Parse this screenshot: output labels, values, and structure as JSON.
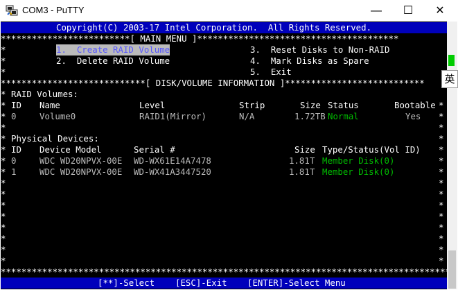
{
  "window": {
    "title": "COM3 - PuTTY",
    "minimize_glyph": "—",
    "maximize_glyph": "☐",
    "close_glyph": "✕"
  },
  "header": {
    "copyright": "Copyright(C) 2003-17 Intel Corporation.  All Rights Reserved."
  },
  "main_menu": {
    "border_line": "*************************[ MAIN MENU ]***************************************",
    "items": [
      {
        "label": "1.  Create RAID Volume"
      },
      {
        "label": "2.  Delete RAID Volume"
      },
      {
        "label": "3.  Reset Disks to Non-RAID"
      },
      {
        "label": "4.  Mark Disks as Spare"
      },
      {
        "label": "5.  Exit"
      }
    ]
  },
  "disk_info": {
    "border_line": "****************************[ DISK/VOLUME INFORMATION ]***************************"
  },
  "raid_volumes": {
    "title": "RAID Volumes:",
    "columns": {
      "id": "ID",
      "name": "Name",
      "level": "Level",
      "strip": "Strip",
      "size": "Size",
      "status": "Status",
      "bootable": "Bootable"
    },
    "rows": [
      {
        "id": "0",
        "name": "Volume0",
        "level": "RAID1(Mirror)",
        "strip": "N/A",
        "size": "1.72TB",
        "status": "Normal",
        "bootable": "Yes"
      }
    ]
  },
  "physical_devices": {
    "title": "Physical Devices:",
    "columns": {
      "id": "ID",
      "model": "Device Model",
      "serial": "Serial #",
      "size": "Size",
      "type_status": "Type/Status(Vol ID)"
    },
    "rows": [
      {
        "id": "0",
        "model": "WDC WD20NPVX-00E",
        "serial": "WD-WX61E14A7478",
        "size": "1.81T",
        "type_status": "Member Disk(0)"
      },
      {
        "id": "1",
        "model": "WDC WD20NPVX-00E",
        "serial": "WD-WX41A3447520",
        "size": "1.81T",
        "type_status": "Member Disk(0)"
      }
    ]
  },
  "footer": {
    "select": "[**]-Select",
    "esc": "[ESC]-Exit",
    "enter": "[ENTER]-Select Menu"
  },
  "border": {
    "side_star": "*",
    "bottom_line": "******************************************************************************************"
  },
  "ime": {
    "label": "英"
  },
  "colors": {
    "terminal_bg": "#000000",
    "band_bg": "#0000bb",
    "text": "#bbbbbb",
    "cyan": "#55ffff",
    "green": "#00bb00",
    "highlight": "#5555ff"
  }
}
